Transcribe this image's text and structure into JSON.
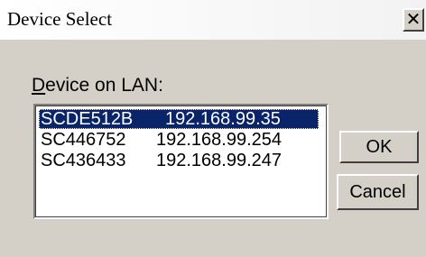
{
  "window": {
    "title": "Device Select",
    "close_glyph": "✕"
  },
  "label": {
    "mnemonic": "D",
    "rest": "evice on LAN:"
  },
  "devices": [
    {
      "name": "SCDE512B",
      "ip": "192.168.99.35",
      "selected": true
    },
    {
      "name": "SC446752",
      "ip": "192.168.99.254",
      "selected": false
    },
    {
      "name": "SC436433",
      "ip": "192.168.99.247",
      "selected": false
    }
  ],
  "buttons": {
    "ok": "OK",
    "cancel": "Cancel"
  },
  "colors": {
    "dialog_bg": "#d4d0c8",
    "selection_bg": "#0a246a",
    "selection_text": "#ffffff"
  }
}
